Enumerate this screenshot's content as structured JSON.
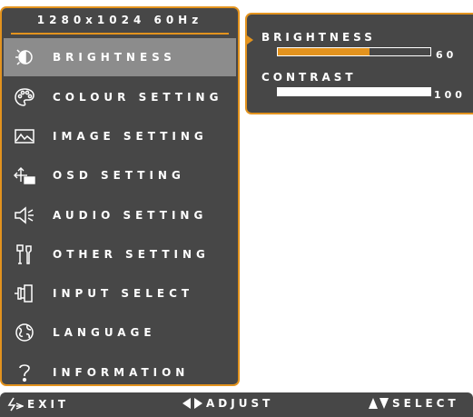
{
  "main_menu": {
    "resolution": "1280x1024 60Hz",
    "items": [
      {
        "label": "BRIGHTNESS",
        "icon": "brightness-icon",
        "selected": true
      },
      {
        "label": "COLOUR SETTING",
        "icon": "palette-icon",
        "selected": false
      },
      {
        "label": "IMAGE SETTING",
        "icon": "image-icon",
        "selected": false
      },
      {
        "label": "OSD SETTING",
        "icon": "osd-icon",
        "selected": false
      },
      {
        "label": "AUDIO SETTING",
        "icon": "speaker-icon",
        "selected": false
      },
      {
        "label": "OTHER SETTING",
        "icon": "tools-icon",
        "selected": false
      },
      {
        "label": "INPUT SELECT",
        "icon": "input-plug-icon",
        "selected": false
      },
      {
        "label": "LANGUAGE",
        "icon": "globe-icon",
        "selected": false
      },
      {
        "label": "INFORMATION",
        "icon": "question-icon",
        "selected": false
      }
    ]
  },
  "submenu": {
    "brightness": {
      "label": "BRIGHTNESS",
      "value": "60",
      "level": 0.6,
      "fill_color": "#e3931e"
    },
    "contrast": {
      "label": "CONTRAST",
      "value": "100",
      "level": 1.0,
      "fill_color": "#ffffff"
    }
  },
  "footer": {
    "exit_label": "EXIT",
    "adjust_label": "ADJUST",
    "select_label": "SELECT"
  },
  "colors": {
    "accent": "#e3931e",
    "panel": "#474747",
    "selected_row": "#8c8c8c"
  }
}
